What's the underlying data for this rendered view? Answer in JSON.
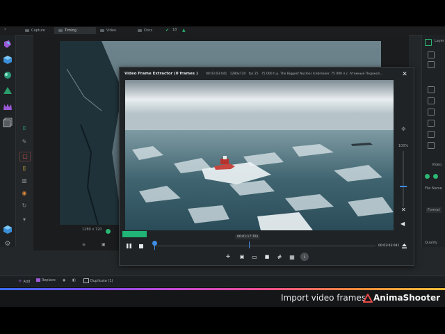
{
  "top_tabs": [
    "Capture",
    "Timing",
    "Video",
    "Docs"
  ],
  "top_badge": "18",
  "frame_extractor": {
    "title": "Video Frame Extractor (0 frames )",
    "timecode": "00:03:03:041",
    "resolution": "1280x720",
    "fps": "fps 25",
    "source_title": "75 000 h.p. The Biggest Nuclear Icebreaker. 75 000 л.с. Атомный Ледокол...",
    "current_time": "00:01:17:702",
    "end_time": "00:03:03:041",
    "zoom": "100%"
  },
  "background_info": "1280 x 720",
  "bottom_toolbar": {
    "add_label": "Add",
    "replace_label": "Replace",
    "duplicate_label": "Duplicate (1)"
  },
  "right_panel": {
    "layers_label": "Layer",
    "video_label": "Video",
    "file_name_label": "File Name",
    "format_label": "Format",
    "quality_label": "Quality"
  },
  "footer": {
    "caption": "Import video frames",
    "brand": "AnimaShooter"
  },
  "colors": {
    "accent": "#3d8ee6",
    "green": "#20b477",
    "dark_bg": "#24272a"
  }
}
